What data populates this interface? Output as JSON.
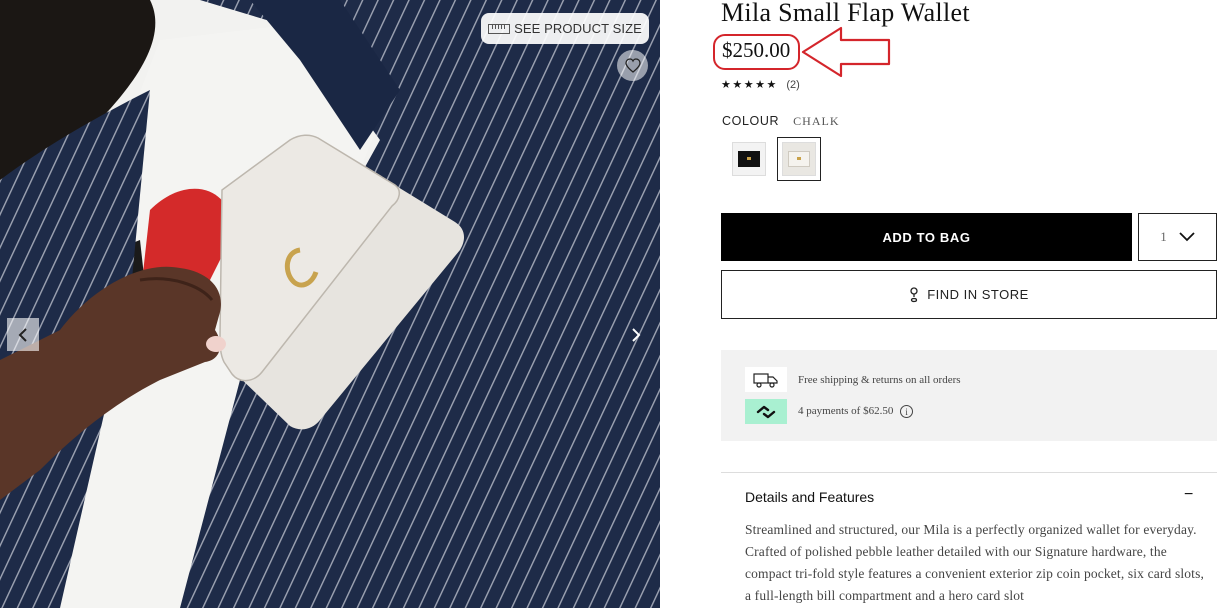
{
  "gallery": {
    "size_button_label": "SEE PRODUCT SIZE"
  },
  "product": {
    "title": "Mila Small Flap Wallet",
    "price": "$250.00",
    "rating": {
      "stars": "★★★★★",
      "count": "(2)"
    },
    "colour_label": "COLOUR",
    "colour_value": "CHALK",
    "swatches": [
      "Black",
      "Chalk"
    ],
    "add_to_bag_label": "ADD TO BAG",
    "quantity": "1",
    "find_in_store_label": "FIND IN STORE"
  },
  "info": {
    "shipping_text": "Free shipping & returns on all orders",
    "payments_text": "4 payments of $62.50",
    "info_symbol": "i"
  },
  "details": {
    "heading": "Details and Features",
    "toggle": "−",
    "body": "Streamlined and structured, our Mila is a perfectly organized wallet for everyday. Crafted of polished pebble leather detailed with our Signature hardware, the compact tri-fold style features a convenient exterior zip coin pocket, six card slots, a full-length bill compartment and a hero card slot"
  },
  "colors": {
    "annotation": "#d4252b",
    "button_bg": "#000000",
    "info_bg": "#f2f2f2",
    "payments_accent": "#a9f0d1"
  },
  "icons": [
    "ruler-icon",
    "heart-icon",
    "chevron-left-icon",
    "chevron-right-icon",
    "chevron-down-icon",
    "map-pin-icon",
    "delivery-truck-icon",
    "afterpay-icon",
    "info-icon",
    "minus-icon"
  ]
}
